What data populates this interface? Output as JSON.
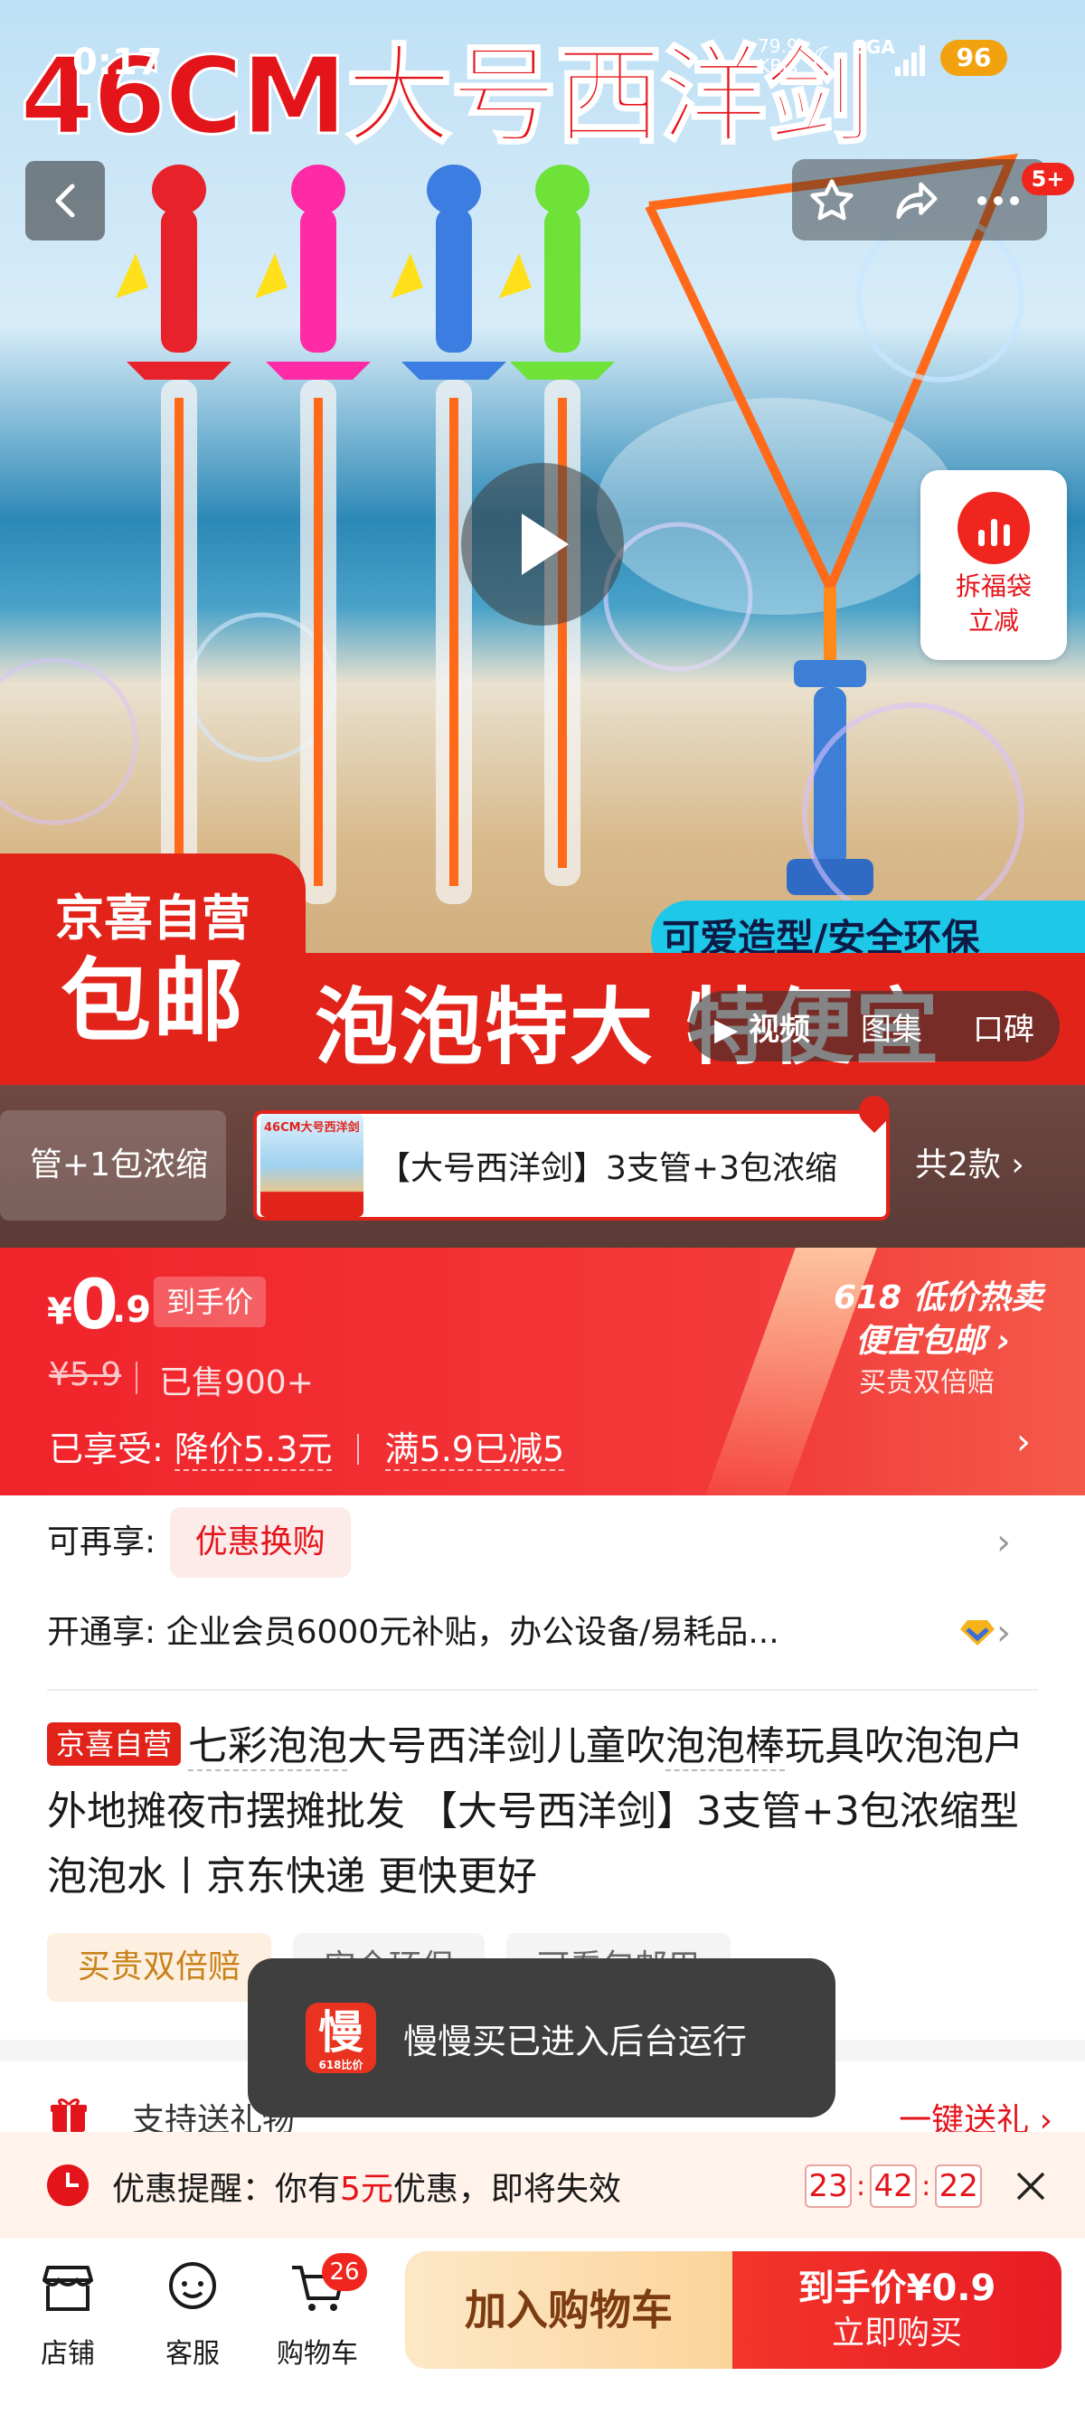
{
  "status": {
    "time": "0:17",
    "speed_top": "79.9",
    "speed_unit": "KB/s",
    "network": "5GA",
    "battery": "96"
  },
  "hero": {
    "title": "46CM大号西洋剑",
    "nav_badge": "5+",
    "red_packet_line1": "拆福袋",
    "red_packet_line2": "立减",
    "badge_line1": "京喜自营",
    "badge_line2": "包邮",
    "slogan": "泡泡特大 特便宜",
    "feature": "可爱造型/安全环保",
    "media_tabs": [
      "视频",
      "图集",
      "口碑"
    ]
  },
  "variants": {
    "prev_label": "管+1包浓缩",
    "thumb_text": "46CM大号西洋剑",
    "selected_label": "【大号西洋剑】3支管+3包浓缩",
    "count": "共2款"
  },
  "price": {
    "currency": "¥",
    "int": "0",
    "dec": ".9",
    "tag": "到手价",
    "original": "¥5.9",
    "sold": "已售900+",
    "discount_prefix": "已享受:",
    "discount_1": "降价5.3元",
    "discount_2": "满5.9已减5",
    "promo_line1": "618 低价热卖",
    "promo_line2": "便宜包邮",
    "promo_line3": "买贵双倍赔"
  },
  "info": {
    "row1_label": "可再享:",
    "row1_coupon": "优惠换购",
    "row2_label": "开通享:",
    "row2_text": "企业会员6000元补贴，办公设备/易耗品..."
  },
  "product": {
    "tag": "京喜自营",
    "title_p1": "七彩泡泡",
    "title_p2": "大号西洋剑儿童吹",
    "title_p3": "泡泡棒",
    "title_p4": "玩具吹泡泡户外地摊夜市摆摊批发 【大号西洋剑】3支管+3包浓缩型泡泡水丨京东快递 更快更好"
  },
  "chips": [
    "买贵双倍赔",
    "安全环保",
    "可看包邮用"
  ],
  "gift": {
    "label": "支持送礼物",
    "action": "一键送礼"
  },
  "toast": {
    "icon_text": "慢",
    "icon_sub": "618比价",
    "message": "慢慢买已进入后台运行"
  },
  "reminder": {
    "prefix": "优惠提醒：你有",
    "amount": "5元",
    "suffix": "优惠，即将失效",
    "hh": "23",
    "mm": "42",
    "ss": "22"
  },
  "bottom": {
    "shop": "店铺",
    "service": "客服",
    "cart": "购物车",
    "cart_count": "26",
    "add_cart": "加入购物车",
    "buy_line1": "到手价¥0.9",
    "buy_line2": "立即购买"
  },
  "colors": {
    "brand_red": "#e1231a",
    "accent_orange": "#fbd49b"
  }
}
